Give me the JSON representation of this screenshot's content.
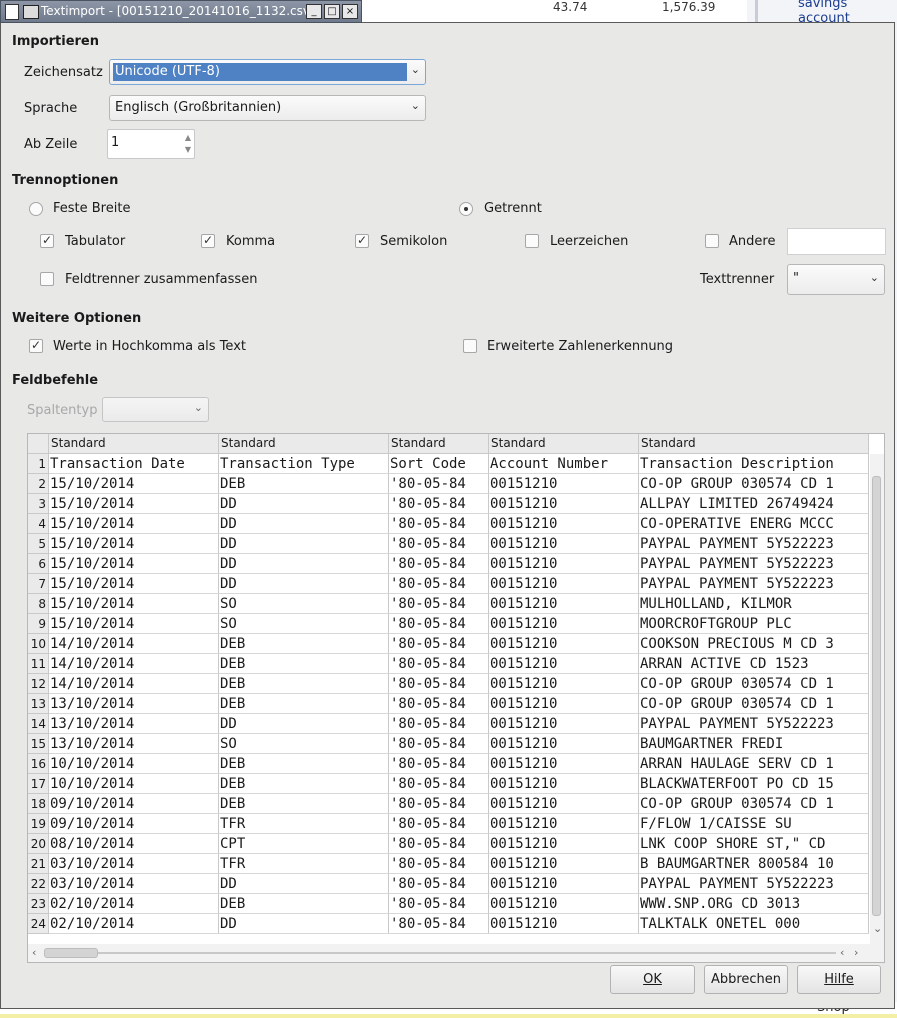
{
  "background": {
    "values": [
      "43.74",
      "1,576.39"
    ],
    "link": "savings account",
    "shop": "Shop"
  },
  "window": {
    "title": "Textimport - [00151210_20141016_1132.csv]",
    "buttons": [
      "_",
      "□",
      "×"
    ]
  },
  "import": {
    "section": "Importieren",
    "charset_label": "Zeichensatz",
    "charset_value": "Unicode (UTF-8)",
    "language_label": "Sprache",
    "language_value": "Englisch (Großbritannien)",
    "from_row_label": "Ab Zeile",
    "from_row_value": "1"
  },
  "separator": {
    "section": "Trennoptionen",
    "fixed_width": "Feste Breite",
    "separated": "Getrennt",
    "tab": "Tabulator",
    "comma": "Komma",
    "semicolon": "Semikolon",
    "space": "Leerzeichen",
    "other": "Andere",
    "merge": "Feldtrenner zusammenfassen",
    "text_delimiter_label": "Texttrenner",
    "text_delimiter_value": "\"",
    "checked": {
      "tab": true,
      "comma": true,
      "semicolon": true,
      "space": false,
      "other": false,
      "merge": false
    },
    "mode": "separated"
  },
  "other_options": {
    "section": "Weitere Optionen",
    "quoted_as_text": "Werte in Hochkomma als Text",
    "quoted_checked": true,
    "detect_special": "Erweiterte Zahlenerkennung",
    "detect_checked": false
  },
  "fields": {
    "section": "Feldbefehle",
    "column_type_label": "Spaltentyp",
    "column_type_value": ""
  },
  "grid": {
    "col_types": [
      "Standard",
      "Standard",
      "Standard",
      "Standard",
      "Standard"
    ],
    "rows": [
      [
        "1",
        "Transaction Date",
        "Transaction Type",
        "Sort Code",
        "Account Number",
        "Transaction Description"
      ],
      [
        "2",
        "15/10/2014",
        "DEB",
        "'80-05-84",
        "00151210",
        "CO-OP GROUP 030574 CD 1"
      ],
      [
        "3",
        "15/10/2014",
        "DD",
        "'80-05-84",
        "00151210",
        "ALLPAY LIMITED 26749424"
      ],
      [
        "4",
        "15/10/2014",
        "DD",
        "'80-05-84",
        "00151210",
        "CO-OPERATIVE ENERG MCCC"
      ],
      [
        "5",
        "15/10/2014",
        "DD",
        "'80-05-84",
        "00151210",
        "PAYPAL PAYMENT 5Y522223"
      ],
      [
        "6",
        "15/10/2014",
        "DD",
        "'80-05-84",
        "00151210",
        "PAYPAL PAYMENT 5Y522223"
      ],
      [
        "7",
        "15/10/2014",
        "DD",
        "'80-05-84",
        "00151210",
        "PAYPAL PAYMENT 5Y522223"
      ],
      [
        "8",
        "15/10/2014",
        "SO",
        "'80-05-84",
        "00151210",
        "MULHOLLAND, KILMOR"
      ],
      [
        "9",
        "15/10/2014",
        "SO",
        "'80-05-84",
        "00151210",
        "MOORCROFTGROUP PLC"
      ],
      [
        "10",
        "14/10/2014",
        "DEB",
        "'80-05-84",
        "00151210",
        "COOKSON PRECIOUS M CD 3"
      ],
      [
        "11",
        "14/10/2014",
        "DEB",
        "'80-05-84",
        "00151210",
        "ARRAN ACTIVE CD 1523"
      ],
      [
        "12",
        "14/10/2014",
        "DEB",
        "'80-05-84",
        "00151210",
        "CO-OP GROUP 030574 CD 1"
      ],
      [
        "13",
        "13/10/2014",
        "DEB",
        "'80-05-84",
        "00151210",
        "CO-OP GROUP 030574 CD 1"
      ],
      [
        "14",
        "13/10/2014",
        "DD",
        "'80-05-84",
        "00151210",
        "PAYPAL PAYMENT 5Y522223"
      ],
      [
        "15",
        "13/10/2014",
        "SO",
        "'80-05-84",
        "00151210",
        "BAUMGARTNER FREDI"
      ],
      [
        "16",
        "10/10/2014",
        "DEB",
        "'80-05-84",
        "00151210",
        "ARRAN HAULAGE SERV CD 1"
      ],
      [
        "17",
        "10/10/2014",
        "DEB",
        "'80-05-84",
        "00151210",
        "BLACKWATERFOOT PO CD 15"
      ],
      [
        "18",
        "09/10/2014",
        "DEB",
        "'80-05-84",
        "00151210",
        "CO-OP GROUP 030574 CD 1"
      ],
      [
        "19",
        "09/10/2014",
        "TFR",
        "'80-05-84",
        "00151210",
        "F/FLOW 1/CAISSE SU"
      ],
      [
        "20",
        "08/10/2014",
        "CPT",
        "'80-05-84",
        "00151210",
        "LNK COOP SHORE ST,\" CD"
      ],
      [
        "21",
        "03/10/2014",
        "TFR",
        "'80-05-84",
        "00151210",
        "B BAUMGARTNER 800584 10"
      ],
      [
        "22",
        "03/10/2014",
        "DD",
        "'80-05-84",
        "00151210",
        "PAYPAL PAYMENT 5Y522223"
      ],
      [
        "23",
        "02/10/2014",
        "DEB",
        "'80-05-84",
        "00151210",
        "WWW.SNP.ORG CD 3013"
      ],
      [
        "24",
        "02/10/2014",
        "DD",
        "'80-05-84",
        "00151210",
        "TALKTALK  ONETEL  000"
      ]
    ]
  },
  "buttons": {
    "ok": "OK",
    "cancel": "Abbrechen",
    "help": "Hilfe"
  }
}
